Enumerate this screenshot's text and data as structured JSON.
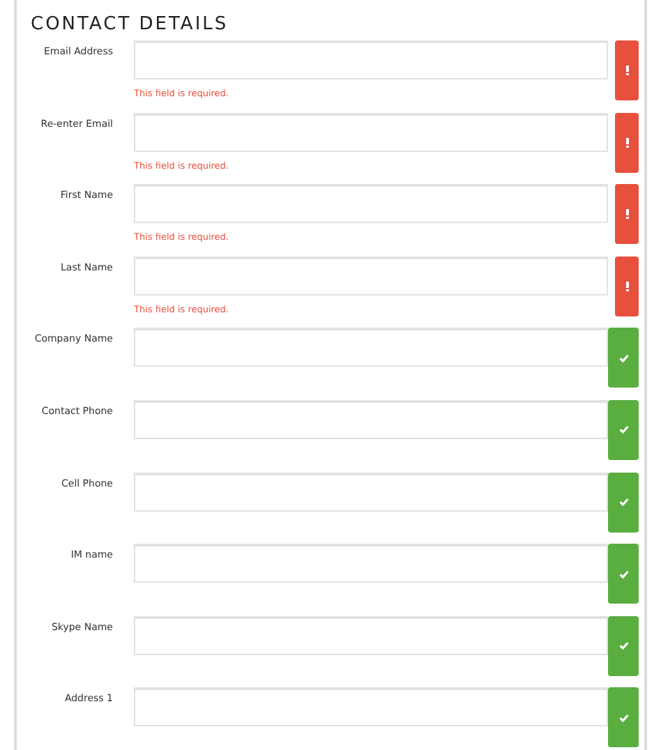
{
  "title": "CONTACT DETAILS",
  "fields": [
    {
      "label": "Email Address",
      "kind": "error",
      "error": "This field is required."
    },
    {
      "label": "Re-enter Email",
      "kind": "error",
      "error": "This field is required."
    },
    {
      "label": "First Name",
      "kind": "error",
      "error": "This field is required."
    },
    {
      "label": "Last Name",
      "kind": "error",
      "error": "This field is required."
    },
    {
      "label": "Company Name",
      "kind": "valid"
    },
    {
      "label": "Contact Phone",
      "kind": "valid"
    },
    {
      "label": "Cell Phone",
      "kind": "valid"
    },
    {
      "label": "IM name",
      "kind": "valid"
    },
    {
      "label": "Skype Name",
      "kind": "valid"
    },
    {
      "label": "Address 1",
      "kind": "valid"
    }
  ]
}
